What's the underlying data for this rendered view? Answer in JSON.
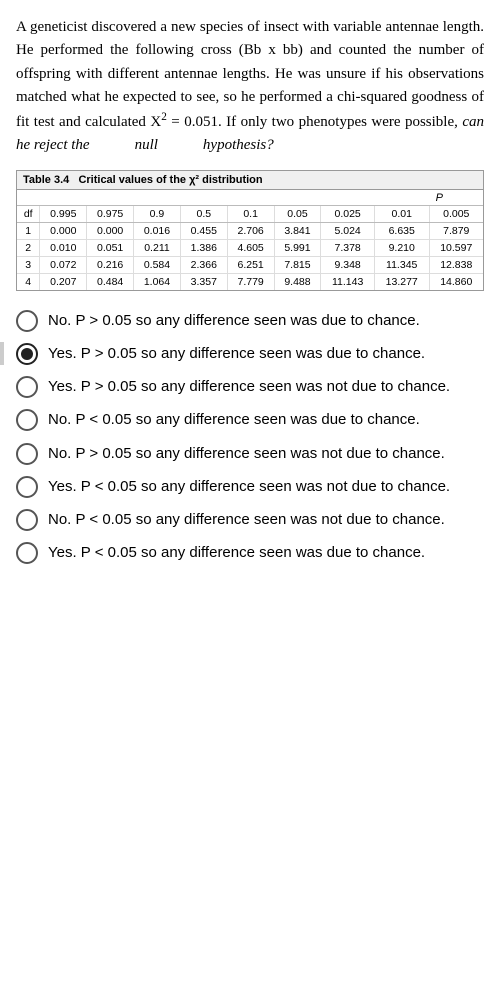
{
  "question": {
    "paragraph": "A geneticist discovered a new species of insect with variable antennae length. He performed the following cross (Bb x bb) and counted the number of offspring with different antennae lengths. He was unsure if his observations matched what he expected to see, so he performed a chi-squared goodness of fit test and calculated X",
    "exponent": "2",
    "paragraph2": " = 0.051. If only two phenotypes were possible,",
    "italic_part": " can he reject the",
    "null_word": "null",
    "hypothesis_word": "hypothesis?"
  },
  "table": {
    "title_number": "Table 3.4",
    "title_text": "Critical values of the χ² distribution",
    "p_label": "P",
    "columns": [
      "df",
      "0.995",
      "0.975",
      "0.9",
      "0.5",
      "0.1",
      "0.05",
      "0.025",
      "0.01",
      "0.005"
    ],
    "rows": [
      [
        "1",
        "0.000",
        "0.000",
        "0.016",
        "0.455",
        "2.706",
        "3.841",
        "5.024",
        "6.635",
        "7.879"
      ],
      [
        "2",
        "0.010",
        "0.051",
        "0.211",
        "1.386",
        "4.605",
        "5.991",
        "7.378",
        "9.210",
        "10.597"
      ],
      [
        "3",
        "0.072",
        "0.216",
        "0.584",
        "2.366",
        "6.251",
        "7.815",
        "9.348",
        "11.345",
        "12.838"
      ],
      [
        "4",
        "0.207",
        "0.484",
        "1.064",
        "3.357",
        "7.779",
        "9.488",
        "11.143",
        "13.277",
        "14.860"
      ]
    ]
  },
  "options": [
    {
      "id": "opt1",
      "text": "No. P > 0.05 so any difference seen was due to chance.",
      "selected": false
    },
    {
      "id": "opt2",
      "text": "Yes. P > 0.05 so any difference seen was due to chance.",
      "selected": true
    },
    {
      "id": "opt3",
      "text": "Yes. P > 0.05 so any difference seen was not due to chance.",
      "selected": false
    },
    {
      "id": "opt4",
      "text": "No. P < 0.05 so any difference seen was due to chance.",
      "selected": false
    },
    {
      "id": "opt5",
      "text": "No. P > 0.05 so any difference seen was not due to chance.",
      "selected": false
    },
    {
      "id": "opt6",
      "text": "Yes. P < 0.05 so any difference seen was not due to chance.",
      "selected": false
    },
    {
      "id": "opt7",
      "text": "No. P < 0.05 so any difference seen was not due to chance.",
      "selected": false
    },
    {
      "id": "opt8",
      "text": "Yes. P < 0.05 so any difference seen was due to chance.",
      "selected": false
    }
  ]
}
